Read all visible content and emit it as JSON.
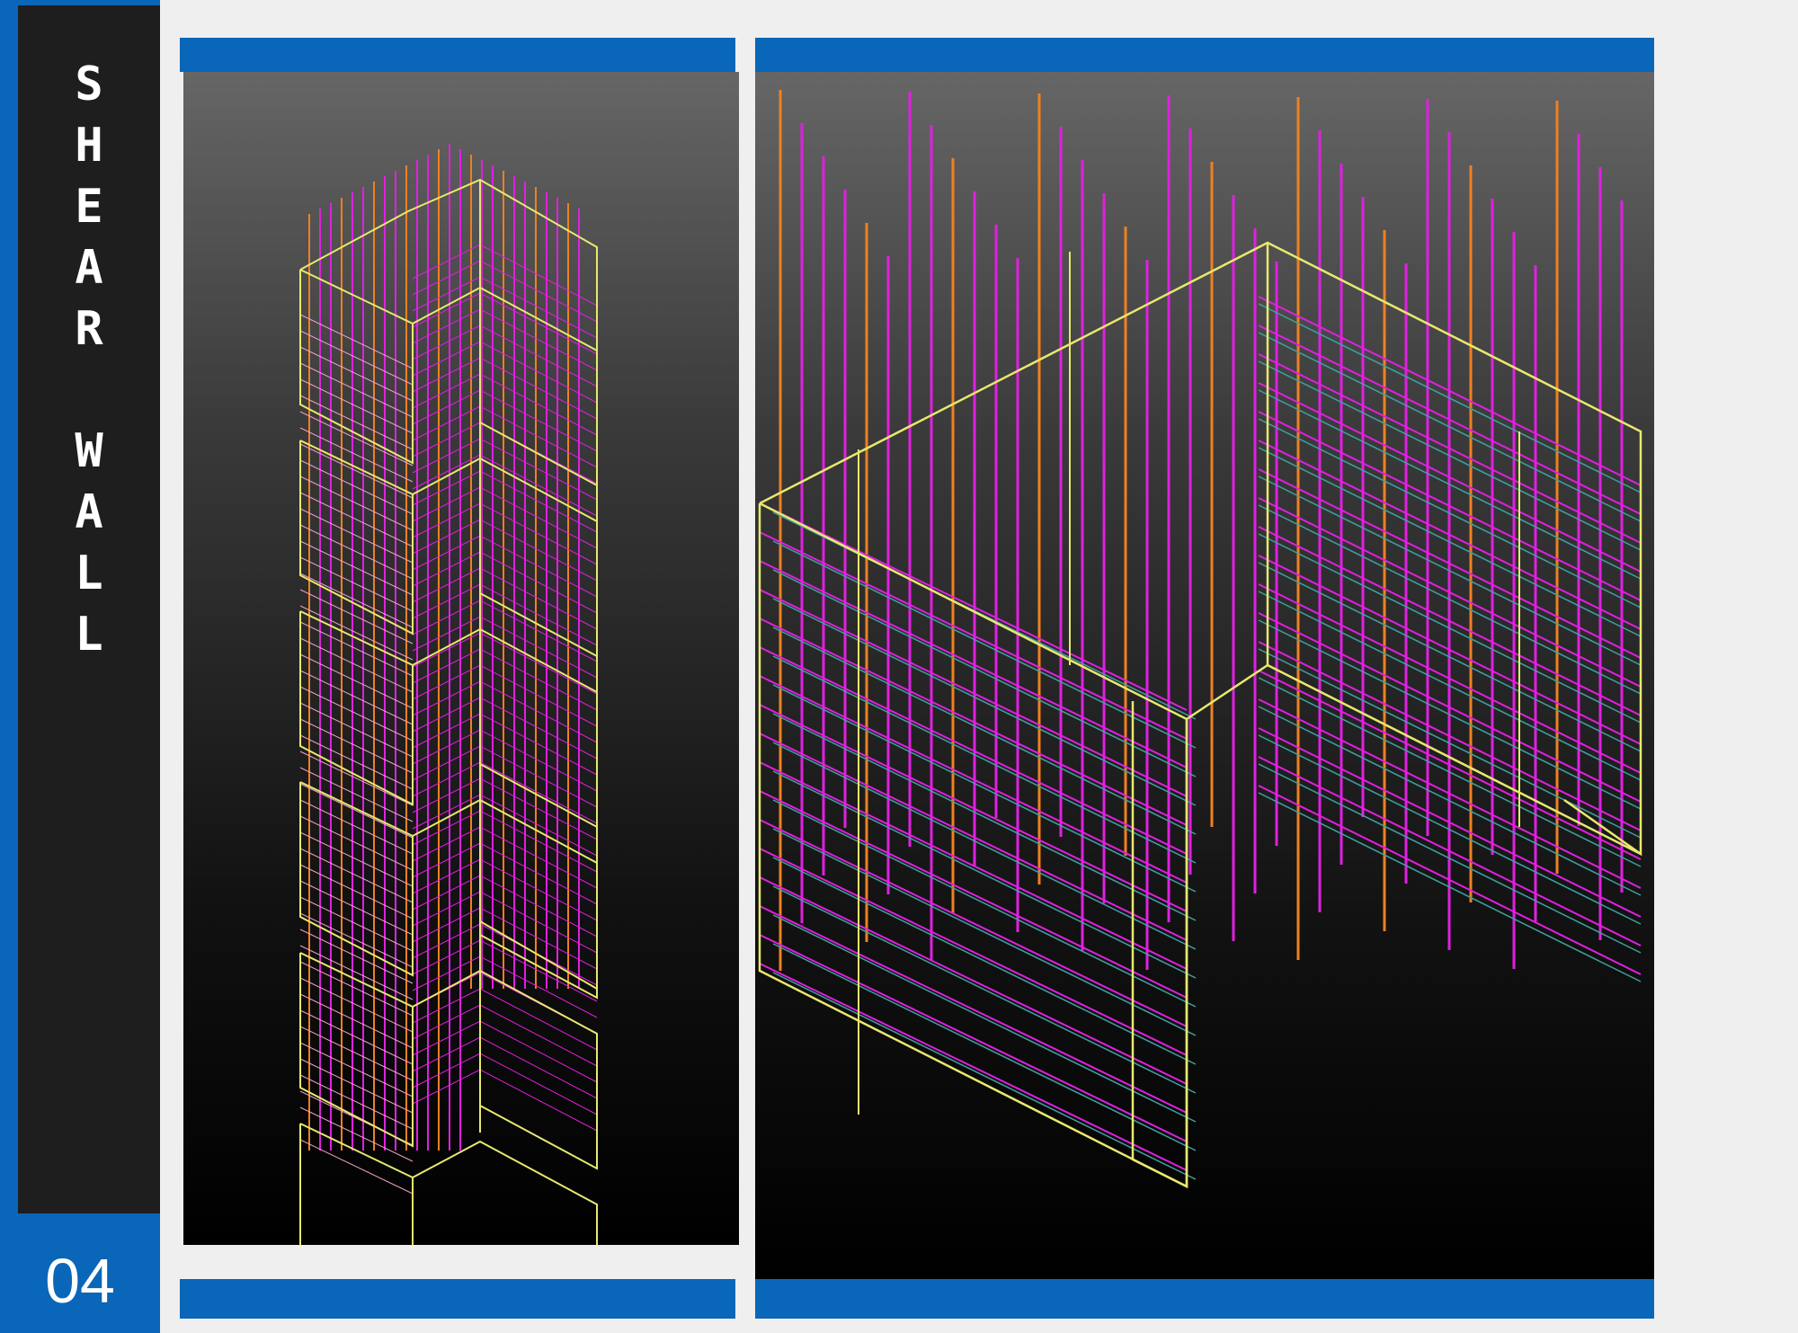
{
  "sidebar": {
    "title_letters": [
      "S",
      "H",
      "E",
      "A",
      "R",
      "",
      "W",
      "A",
      "L",
      "L"
    ],
    "page_number": "04"
  },
  "colors": {
    "accent_blue": "#0a66b8",
    "sidebar_dark": "#1e1e1e",
    "rebar_magenta": "#e020e0",
    "rebar_orange": "#f08020",
    "concrete_outline": "#e8e870",
    "ties_pink": "#f0a0c8",
    "ties_teal": "#40a0a0"
  },
  "views": [
    {
      "name": "shear-wall-column-3d-view",
      "icon": "rebar-cage-column-icon"
    },
    {
      "name": "shear-wall-u-core-3d-view",
      "icon": "rebar-cage-u-wall-icon"
    }
  ]
}
